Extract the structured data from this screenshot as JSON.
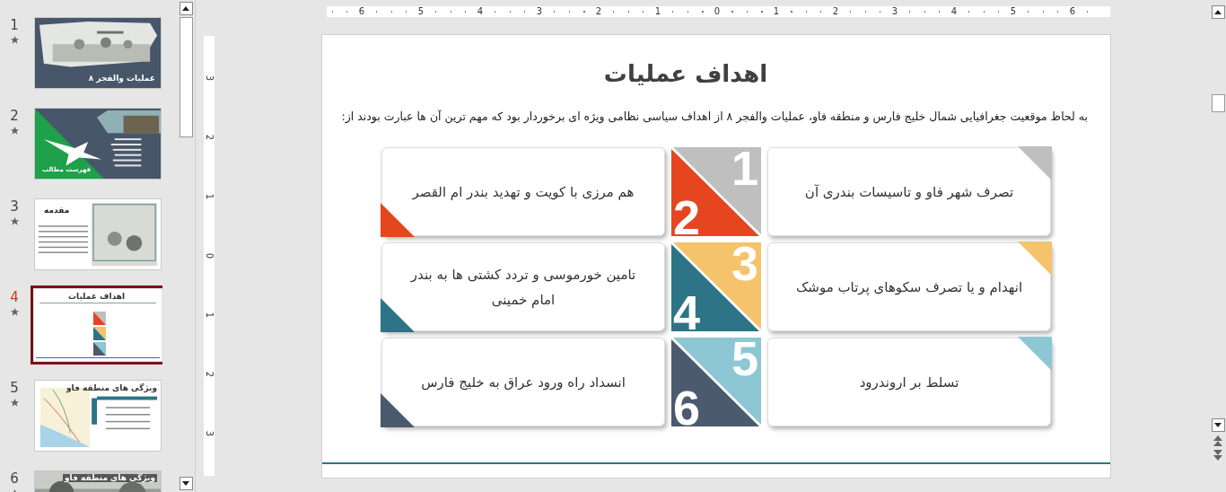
{
  "slide_panel": {
    "slides": [
      {
        "number": "1",
        "title": "عملیات والفجر ۸",
        "kind": "title",
        "selected": false
      },
      {
        "number": "2",
        "title": "فهرست مطالب",
        "kind": "contents",
        "selected": false
      },
      {
        "number": "3",
        "title": "مقدمه",
        "kind": "intro",
        "selected": false
      },
      {
        "number": "4",
        "title": "اهداف عملیات",
        "kind": "goals",
        "selected": true
      },
      {
        "number": "5",
        "title": "ویژگی های منطقه فاو",
        "kind": "map",
        "selected": false
      },
      {
        "number": "6",
        "title": "ویژگی های منطقه فاو",
        "selected": false
      }
    ]
  },
  "rulers": {
    "horizontal": [
      "6",
      "5",
      "4",
      "3",
      "2",
      "1",
      "0",
      "1",
      "2",
      "3",
      "4",
      "5",
      "6"
    ],
    "vertical": [
      "3",
      "2",
      "1",
      "0",
      "1",
      "2",
      "3"
    ]
  },
  "slide": {
    "title": "اهداف عملیات",
    "intro": "به لحاظ موقعیت جغرافیایی شمال خلیج فارس و منطقه فاو، عملیات والفجر ۸ از اهداف سیاسی نظامی ویژه ای برخوردار بود که مهم ترین آن ها عبارت بودند از:",
    "rows": [
      {
        "right": {
          "number": "1",
          "color": "#bfbfbf",
          "text": "تصرف شهر فاو و تاسیسات بندری آن"
        },
        "left": {
          "number": "2",
          "color": "#e5461f",
          "text": "هم مرزی با کویت و تهدید بندر ام القصر"
        }
      },
      {
        "right": {
          "number": "3",
          "color": "#f5c36c",
          "text": "انهدام و یا تصرف سکوهای پرتاب موشک"
        },
        "left": {
          "number": "4",
          "color": "#2e7487",
          "text": "تامین خورموسی و تردد کشتی ها به بندر امام خمینی"
        }
      },
      {
        "right": {
          "number": "5",
          "color": "#8cc7d3",
          "text": "تسلط بر اروندرود"
        },
        "left": {
          "number": "6",
          "color": "#4b5a6f",
          "text": "انسداد راه ورود عراق به خلیج فارس"
        }
      }
    ]
  }
}
